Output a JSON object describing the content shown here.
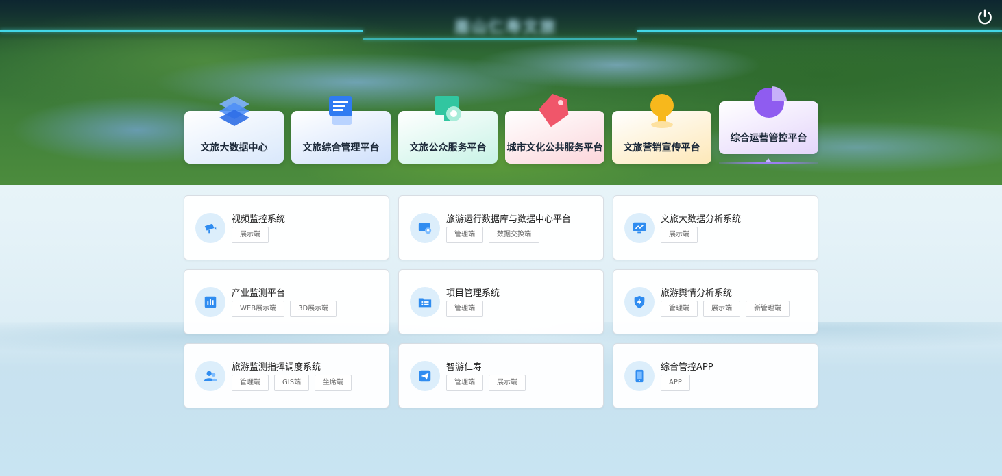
{
  "header": {
    "title": "眉山仁寿文旅",
    "power_icon": "power-icon"
  },
  "platforms": [
    {
      "label": "文旅大数据中心",
      "icon": "layers-icon",
      "color": "#4f8ff7"
    },
    {
      "label": "文旅综合管理平台",
      "icon": "document-icon",
      "color": "#2f7bf2"
    },
    {
      "label": "文旅公众服务平台",
      "icon": "monitor-gear-icon",
      "color": "#31c6a0"
    },
    {
      "label": "城市文化公共服务平台",
      "icon": "tag-icon",
      "color": "#f0566a"
    },
    {
      "label": "文旅营销宣传平台",
      "icon": "trophy-icon",
      "color": "#f7b81c"
    },
    {
      "label": "综合运营管控平台",
      "icon": "pie-chart-icon",
      "color": "#8f5cf0",
      "active": true
    }
  ],
  "systems": [
    {
      "title": "视频监控系统",
      "icon": "video-camera-icon",
      "tags": [
        "展示端"
      ]
    },
    {
      "title": "旅游运行数据库与数据中心平台",
      "icon": "database-screen-icon",
      "tags": [
        "管理端",
        "数据交换端"
      ]
    },
    {
      "title": "文旅大数据分析系统",
      "icon": "line-chart-monitor-icon",
      "tags": [
        "展示端"
      ]
    },
    {
      "title": "产业监测平台",
      "icon": "bar-chart-icon",
      "tags": [
        "WEB展示端",
        "3D展示端"
      ]
    },
    {
      "title": "项目管理系统",
      "icon": "list-folder-icon",
      "tags": [
        "管理端"
      ]
    },
    {
      "title": "旅游舆情分析系统",
      "icon": "shield-bolt-icon",
      "tags": [
        "管理端",
        "展示端",
        "新管理端"
      ]
    },
    {
      "title": "旅游监测指挥调度系统",
      "icon": "users-icon",
      "tags": [
        "管理端",
        "GIS端",
        "坐席端"
      ]
    },
    {
      "title": "智游仁寿",
      "icon": "paper-plane-icon",
      "tags": [
        "管理端",
        "展示端"
      ]
    },
    {
      "title": "综合管控APP",
      "icon": "mobile-phone-icon",
      "tags": [
        "APP"
      ]
    }
  ],
  "colors": {
    "accent": "#2f8cf0",
    "icon_bg": "#dceefb"
  }
}
